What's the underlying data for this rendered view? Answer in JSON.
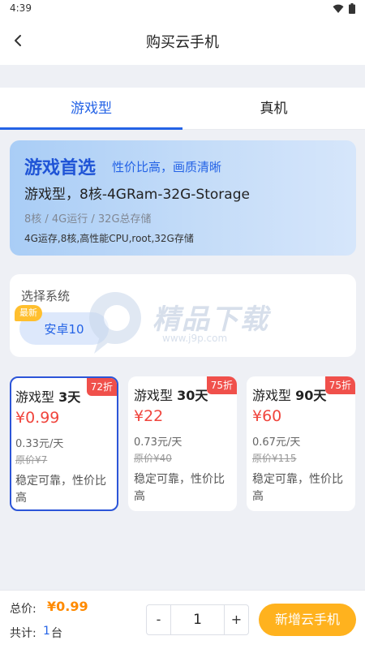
{
  "status": {
    "time": "4:39",
    "icons": [
      "wifi-icon",
      "battery-icon"
    ]
  },
  "header": {
    "title": "购买云手机",
    "back_icon": "chevron-left-icon"
  },
  "tabs": [
    {
      "label": "游戏型",
      "active": true
    },
    {
      "label": "真机",
      "active": false
    }
  ],
  "hero": {
    "title": "游戏首选",
    "slogan": "性价比高，画质清晰",
    "subtitle": "游戏型，8核-4GRam-32G-Storage",
    "specs": "8核 / 4G运行 / 32G总存储",
    "detail": "4G运存,8核,高性能CPU,root,32G存储"
  },
  "system": {
    "label": "选择系统",
    "badge": "最新",
    "option": "安卓10"
  },
  "watermark": {
    "text": "精品下载",
    "url": "www.j9p.com"
  },
  "plans": [
    {
      "name_prefix": "游戏型 ",
      "days": "3天",
      "discount": "72折",
      "price": "¥0.99",
      "daily": "0.33元/天",
      "original": "原价¥7",
      "desc": "稳定可靠，性价比高",
      "selected": true
    },
    {
      "name_prefix": "游戏型 ",
      "days": "30天",
      "discount": "75折",
      "price": "¥22",
      "daily": "0.73元/天",
      "original": "原价¥40",
      "desc": "稳定可靠，性价比高",
      "selected": false
    },
    {
      "name_prefix": "游戏型 ",
      "days": "90天",
      "discount": "75折",
      "price": "¥60",
      "daily": "0.67元/天",
      "original": "原价¥115",
      "desc": "稳定可靠，性价比高",
      "selected": false
    }
  ],
  "footer": {
    "total_label": "总价:",
    "total_value": "¥0.99",
    "count_label": "共计:",
    "count_value": "1",
    "count_unit": "台",
    "quantity": "1",
    "minus": "-",
    "plus": "+",
    "add_button": "新增云手机"
  },
  "colors": {
    "accent": "#2463e6",
    "price": "#f0453d",
    "discount": "#f0504b",
    "cta": "#ffb21e",
    "total": "#ff8a00"
  }
}
